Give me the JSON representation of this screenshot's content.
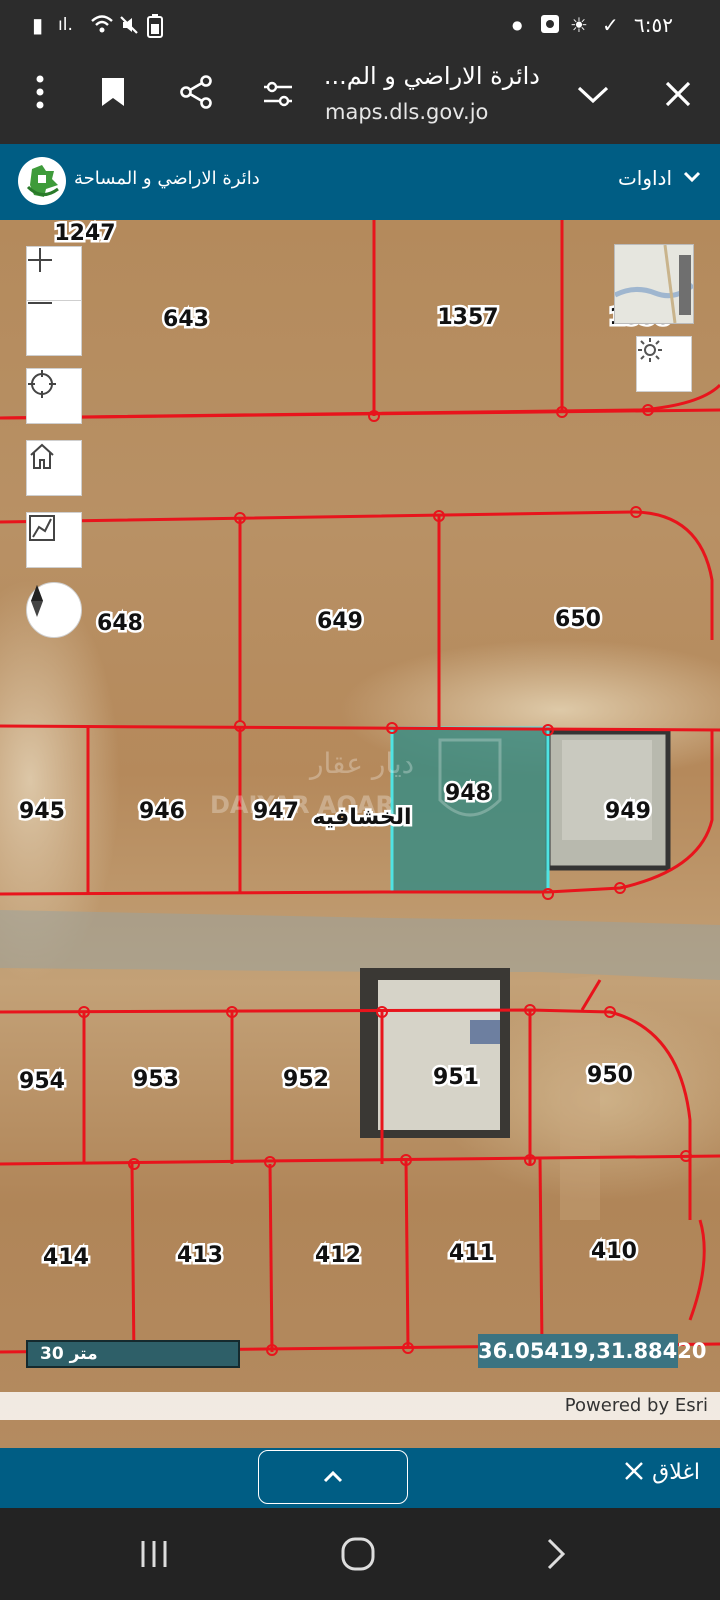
{
  "status_bar": {
    "time": "٦:٥٢",
    "icons": [
      "screenshot-icon",
      "photo-icon",
      "signal-icon",
      "wifi-icon",
      "mute-icon",
      "battery-icon",
      "dot-icon",
      "sun-icon",
      "check-icon"
    ]
  },
  "browser": {
    "page_title": "دائرة الاراضي و الم...",
    "url": "maps.dls.gov.jo",
    "icons": [
      "more-vert-icon",
      "bookmark-icon",
      "share-icon",
      "page-settings-icon",
      "chevron-down-icon",
      "close-icon"
    ]
  },
  "app_header": {
    "title": "دائرة الاراضي و المساحة",
    "tools_label": "اداوات"
  },
  "map": {
    "parcels": [
      "1247",
      "643",
      "1357",
      "1358",
      "648",
      "649",
      "650",
      "945",
      "946",
      "947",
      "948",
      "949",
      "954",
      "953",
      "952",
      "951",
      "950",
      "414",
      "413",
      "412",
      "411",
      "410"
    ],
    "area_label": "الخشافيه",
    "watermark": "ديار عقار DAIYAR AQAR",
    "controls": [
      "zoom-in-icon",
      "zoom-out-icon",
      "locate-icon",
      "home-icon",
      "measure-icon",
      "compass-icon",
      "basemap-thumbnail",
      "brightness-icon"
    ],
    "scale_label": "30 متر",
    "coordinates": "36.05419,31.88420",
    "attribution": "Powered by Esri",
    "highlight_color": "#4fe3e3",
    "boundary_color": "#e8141c"
  },
  "bottom_panel": {
    "close_label": "اغلاق",
    "icons": [
      "chevron-up-icon",
      "close-x-icon"
    ]
  },
  "nav_bar": {
    "icons": [
      "recent-apps-icon",
      "home-circle-icon",
      "back-icon"
    ]
  },
  "colors": {
    "header_blue": "#005d84",
    "system_bar": "#2c2c2c"
  }
}
